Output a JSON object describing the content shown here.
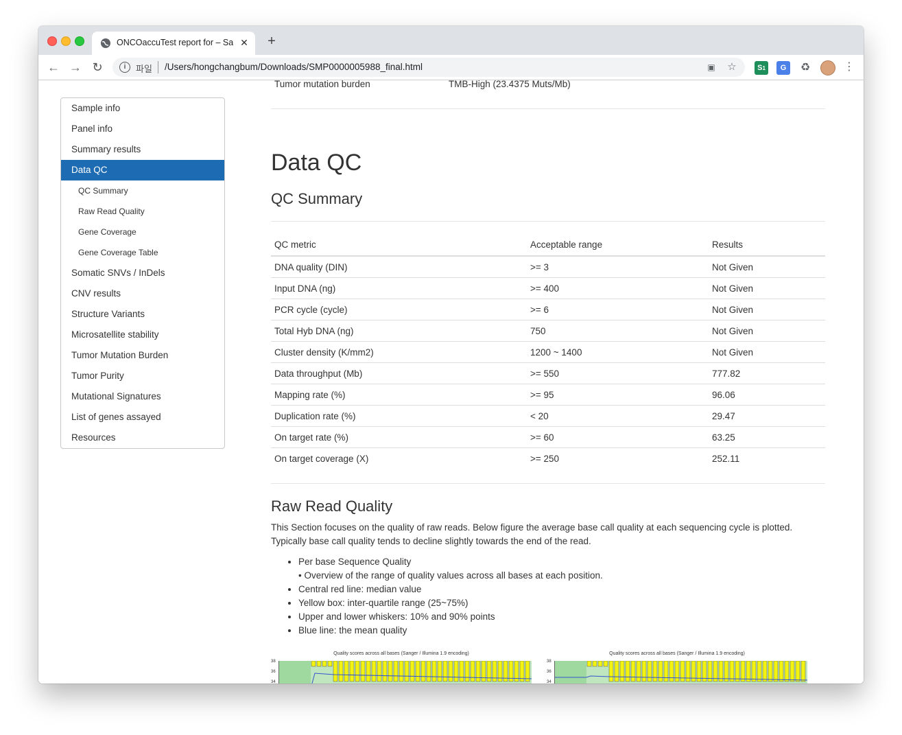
{
  "browser": {
    "tab_title": "ONCOaccuTest report for – Sample",
    "tab_close": "✕",
    "new_tab": "+",
    "scheme_label": "파일",
    "url": "/Users/hongchangbum/Downloads/SMP0000005988_final.html",
    "ext_badge": "1"
  },
  "sidebar": {
    "items": [
      {
        "label": "Sample info",
        "active": false,
        "sub": false
      },
      {
        "label": "Panel info",
        "active": false,
        "sub": false
      },
      {
        "label": "Summary results",
        "active": false,
        "sub": false
      },
      {
        "label": "Data QC",
        "active": true,
        "sub": false
      },
      {
        "label": "QC Summary",
        "active": false,
        "sub": true
      },
      {
        "label": "Raw Read Quality",
        "active": false,
        "sub": true
      },
      {
        "label": "Gene Coverage",
        "active": false,
        "sub": true
      },
      {
        "label": "Gene Coverage Table",
        "active": false,
        "sub": true
      },
      {
        "label": "Somatic SNVs / InDels",
        "active": false,
        "sub": false
      },
      {
        "label": "CNV results",
        "active": false,
        "sub": false
      },
      {
        "label": "Structure Variants",
        "active": false,
        "sub": false
      },
      {
        "label": "Microsatellite stability",
        "active": false,
        "sub": false
      },
      {
        "label": "Tumor Mutation Burden",
        "active": false,
        "sub": false
      },
      {
        "label": "Tumor Purity",
        "active": false,
        "sub": false
      },
      {
        "label": "Mutational Signatures",
        "active": false,
        "sub": false
      },
      {
        "label": "List of genes assayed",
        "active": false,
        "sub": false
      },
      {
        "label": "Resources",
        "active": false,
        "sub": false
      }
    ]
  },
  "main": {
    "tmb_label": "Tumor mutation burden",
    "tmb_value": "TMB-High (23.4375 Muts/Mb)",
    "section_title": "Data QC",
    "qc_title": "QC Summary",
    "qc_table": {
      "headers": [
        "QC metric",
        "Acceptable range",
        "Results"
      ],
      "rows": [
        [
          "DNA quality (DIN)",
          ">= 3",
          "Not Given"
        ],
        [
          "Input DNA (ng)",
          ">= 400",
          "Not Given"
        ],
        [
          "PCR cycle (cycle)",
          ">= 6",
          "Not Given"
        ],
        [
          "Total Hyb DNA (ng)",
          "750",
          "Not Given"
        ],
        [
          "Cluster density (K/mm2)",
          "1200 ~ 1400",
          "Not Given"
        ],
        [
          "Data throughput (Mb)",
          ">= 550",
          "777.82"
        ],
        [
          "Mapping rate (%)",
          ">= 95",
          "96.06"
        ],
        [
          "Duplication rate (%)",
          "< 20",
          "29.47"
        ],
        [
          "On target rate (%)",
          ">= 60",
          "63.25"
        ],
        [
          "On target coverage (X)",
          ">= 250",
          "252.11"
        ]
      ]
    },
    "raw_title": "Raw Read Quality",
    "raw_paragraph": "This Section focuses on the quality of raw reads. Below figure the average base call quality at each sequencing cycle is plotted. Typically base call quality tends to decline slightly towards the end of the read.",
    "bullets": [
      "Per base Sequence Quality",
      "Central red line: median value",
      "Yellow box: inter-quartile range (25~75%)",
      "Upper and lower whiskers: 10% and 90% points",
      "Blue line: the mean quality"
    ],
    "bullet_sub": "• Overview of the range of quality values across all bases at each position.",
    "figure_title": "Quality scores across all bases (Sanger / Illumina 1.9 encoding)",
    "figure_axis": [
      "38",
      "36",
      "34"
    ]
  },
  "colors": {
    "accent": "#1d6bb3",
    "plot_bg": "#bfe6bf",
    "box_yellow": "#f3f312"
  }
}
